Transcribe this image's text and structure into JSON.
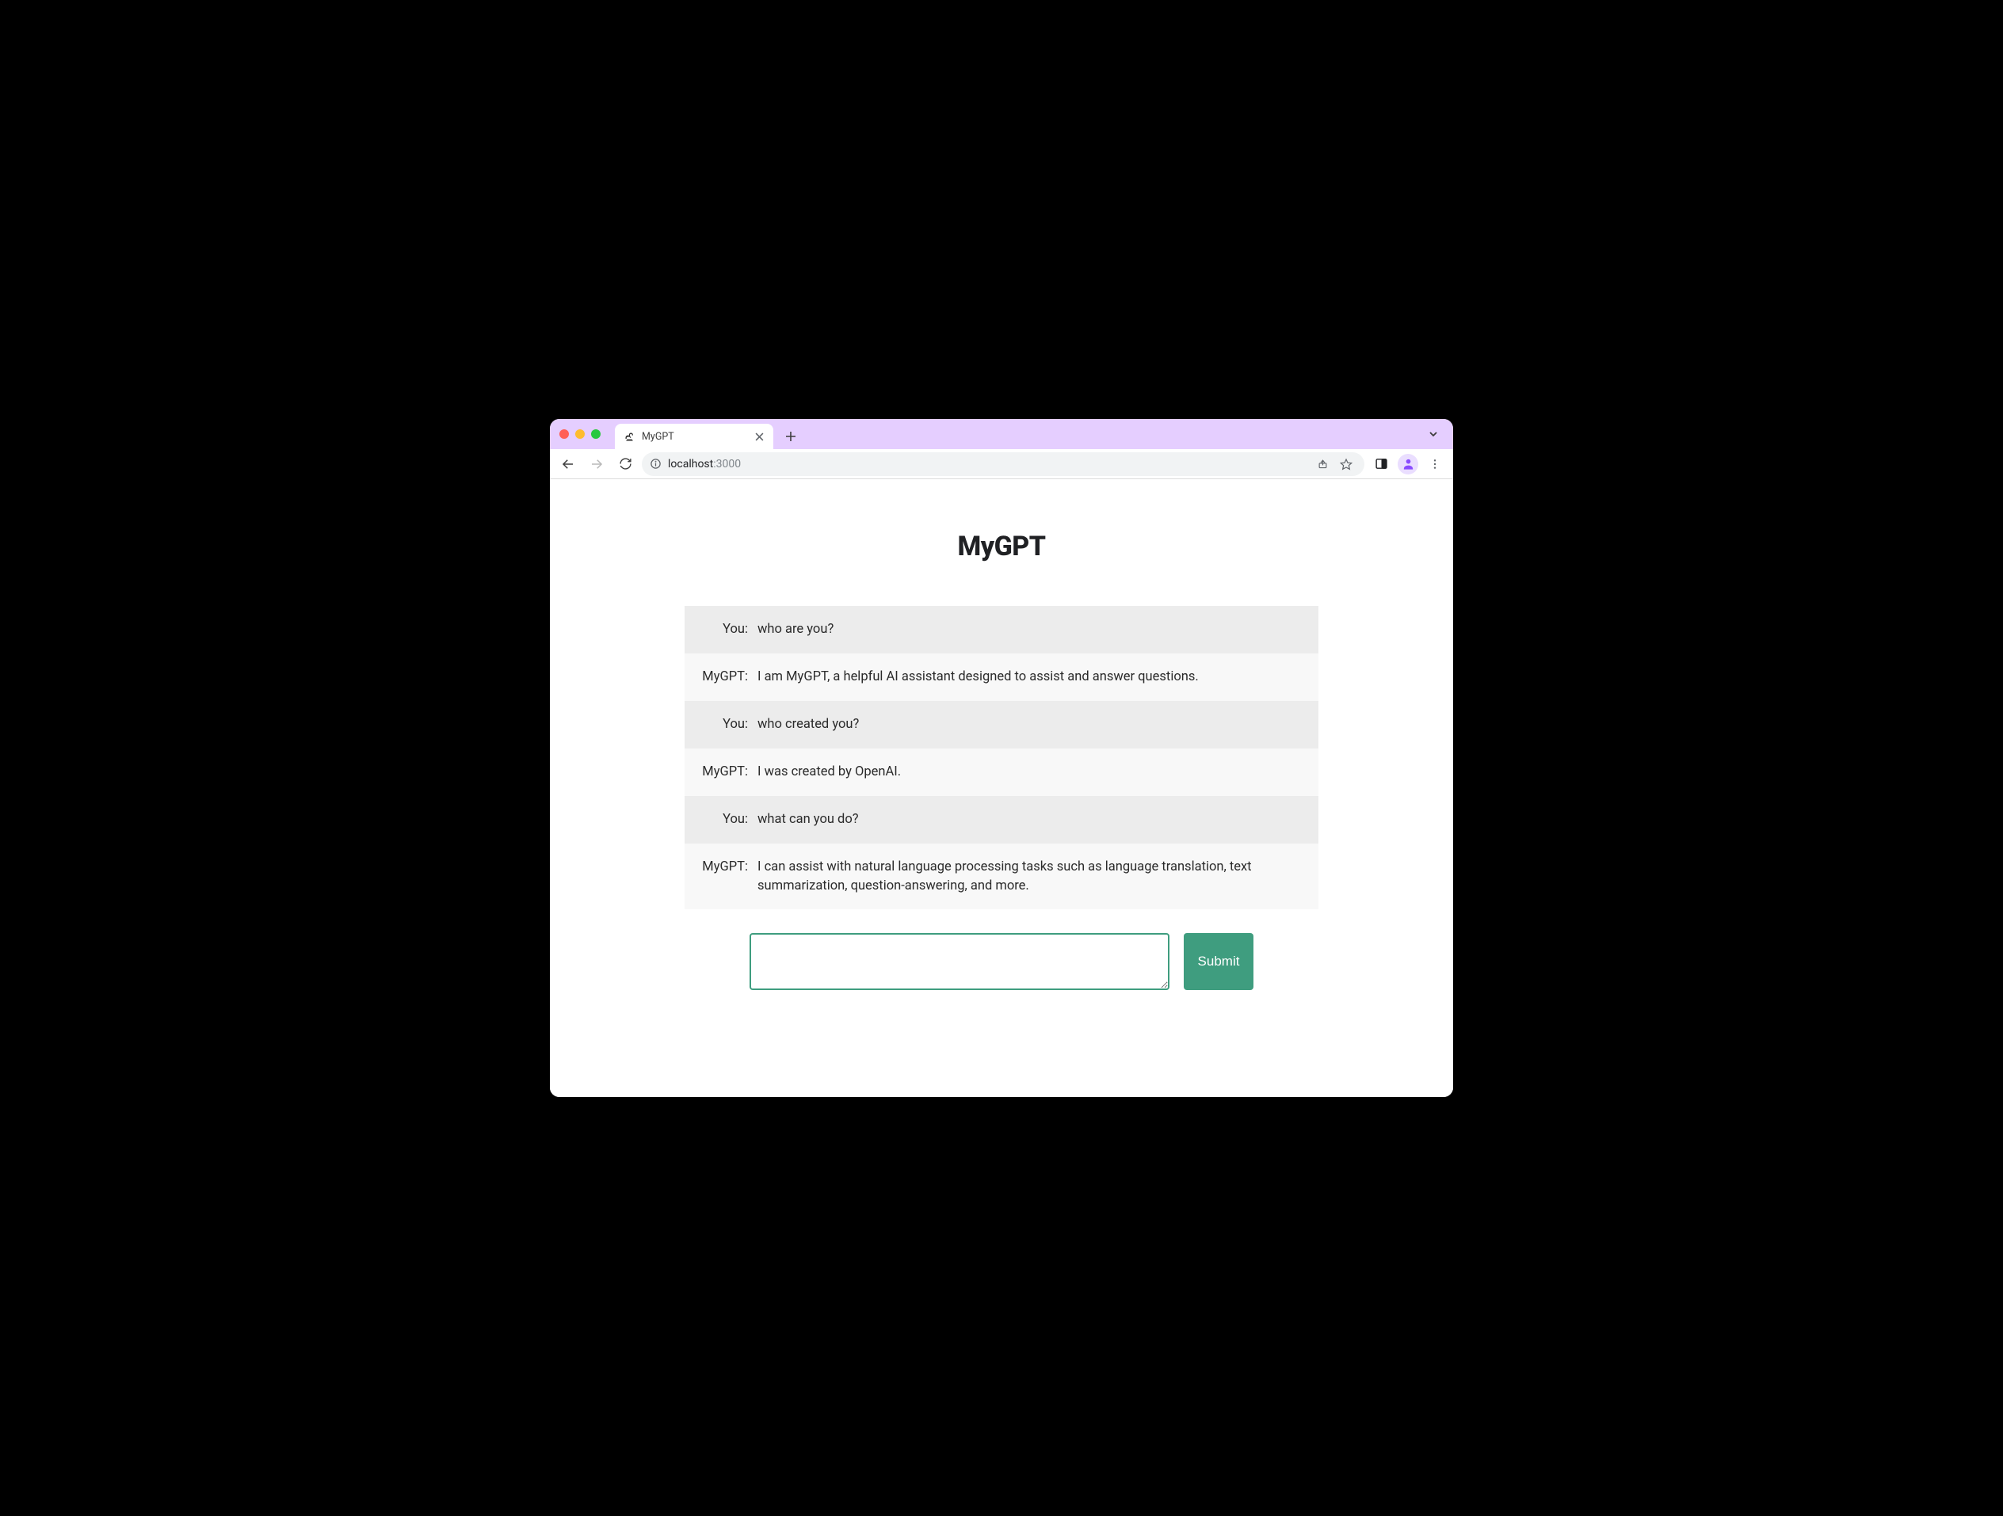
{
  "browser": {
    "tab_title": "MyGPT",
    "address_host": "localhost",
    "address_path": ":3000"
  },
  "page": {
    "title": "MyGPT",
    "labels": {
      "user": "You:",
      "assistant": "MyGPT:"
    },
    "messages": [
      {
        "role": "user",
        "text": "who are you?"
      },
      {
        "role": "assistant",
        "text": "I am MyGPT, a helpful AI assistant designed to assist and answer questions."
      },
      {
        "role": "user",
        "text": "who created you?"
      },
      {
        "role": "assistant",
        "text": "I was created by OpenAI."
      },
      {
        "role": "user",
        "text": "what can you do?"
      },
      {
        "role": "assistant",
        "text": "I can assist with natural language processing tasks such as language translation, text summarization, question-answering, and more."
      }
    ],
    "input_value": "",
    "submit_label": "Submit"
  }
}
